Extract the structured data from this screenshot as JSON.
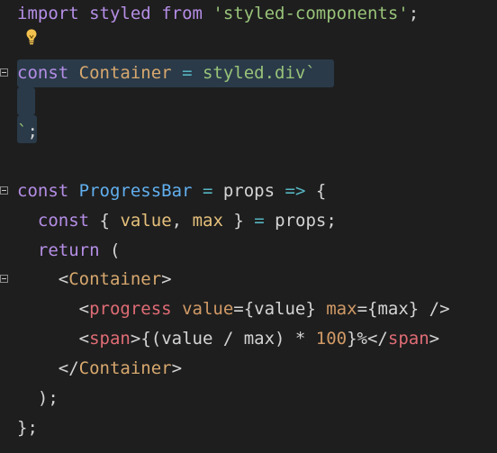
{
  "editor": {
    "language": "javascript",
    "colors": {
      "background": "#1e1e1e",
      "selection": "#2a3a49",
      "keyword": "#c586c0",
      "className": "#d7a86e",
      "function": "#61afef",
      "string": "#98c379",
      "operator": "#56b6c2",
      "tag": "#e06c75",
      "attribute": "#d19a66",
      "text": "#d4d4d4"
    },
    "icons": [
      "lightbulb-icon",
      "fold-icon"
    ],
    "lines": [
      "import styled from 'styled-components';",
      "",
      "const Container = styled.div`",
      "",
      "`;",
      "",
      "const ProgressBar = props => {",
      "  const { value, max } = props;",
      "  return (",
      "    <Container>",
      "      <progress value={value} max={max} />",
      "      <span>{(value / max) * 100}%</span>",
      "    </Container>",
      "  );",
      "};"
    ]
  }
}
